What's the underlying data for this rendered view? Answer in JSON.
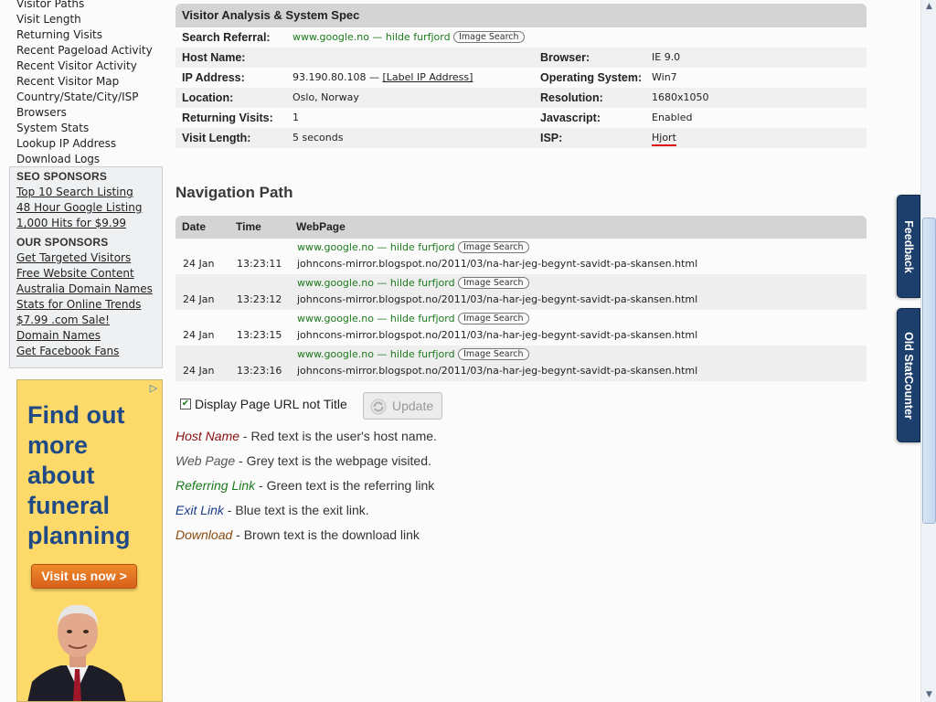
{
  "sidebar": {
    "links": [
      "Visitor Paths",
      "Visit Length",
      "Returning Visits",
      "Recent Pageload Activity",
      "Recent Visitor Activity",
      "Recent Visitor Map",
      "Country/State/City/ISP",
      "Browsers",
      "System Stats",
      "Lookup IP Address",
      "Download Logs"
    ],
    "seo_header": "SEO SPONSORS",
    "seo_links": [
      "Top 10 Search Listing",
      "48 Hour Google Listing",
      "1,000 Hits for $9.99"
    ],
    "our_header": "OUR SPONSORS",
    "our_links": [
      "Get Targeted Visitors",
      "Free Website Content",
      "Australia Domain Names",
      "Stats for Online Trends",
      "$7.99 .com Sale!",
      "Domain Names",
      "Get Facebook Fans"
    ]
  },
  "ad": {
    "headline_lines": [
      "Find out",
      "more",
      "about",
      "funeral",
      "planning"
    ],
    "cta": "Visit us now  >",
    "adchoices_icon": "adchoices-icon"
  },
  "spec": {
    "title": "Visitor Analysis & System Spec",
    "search_referral_label": "Search Referral:",
    "search_referral_value": "www.google.no — hilde furfjord",
    "image_search": "Image Search",
    "host_name_label": "Host Name:",
    "host_name_value": "",
    "ip_label": "IP Address:",
    "ip_value": "93.190.80.108 —",
    "label_ip": "[Label IP Address]",
    "location_label": "Location:",
    "location_value": "Oslo, Norway",
    "returning_label": "Returning Visits:",
    "returning_value": "1",
    "visit_length_label": "Visit Length:",
    "visit_length_value": "5 seconds",
    "browser_label": "Browser:",
    "browser_value": "IE 9.0",
    "os_label": "Operating System:",
    "os_value": "Win7",
    "resolution_label": "Resolution:",
    "resolution_value": "1680x1050",
    "javascript_label": "Javascript:",
    "javascript_value": "Enabled",
    "isp_label": "ISP:",
    "isp_value": "Hjort"
  },
  "nav": {
    "title": "Navigation Path",
    "col_date": "Date",
    "col_time": "Time",
    "col_webpage": "WebPage",
    "rows": [
      {
        "referrer": "www.google.no — hilde furfjord",
        "chip": "Image Search",
        "date": "24 Jan",
        "time": "13:23:11",
        "page": "johncons-mirror.blogspot.no/2011/03/na-har-jeg-begynt-savidt-pa-skansen.html"
      },
      {
        "referrer": "www.google.no — hilde furfjord",
        "chip": "Image Search",
        "date": "24 Jan",
        "time": "13:23:12",
        "page": "johncons-mirror.blogspot.no/2011/03/na-har-jeg-begynt-savidt-pa-skansen.html"
      },
      {
        "referrer": "www.google.no — hilde furfjord",
        "chip": "Image Search",
        "date": "24 Jan",
        "time": "13:23:15",
        "page": "johncons-mirror.blogspot.no/2011/03/na-har-jeg-begynt-savidt-pa-skansen.html"
      },
      {
        "referrer": "www.google.no — hilde furfjord",
        "chip": "Image Search",
        "date": "24 Jan",
        "time": "13:23:16",
        "page": "johncons-mirror.blogspot.no/2011/03/na-har-jeg-begynt-savidt-pa-skansen.html"
      }
    ]
  },
  "controls": {
    "checkbox_label": "Display Page URL not Title",
    "checkbox_checked": true,
    "update_label": "Update"
  },
  "legend": [
    {
      "term": "Host Name",
      "desc": " - Red text is the user's host name."
    },
    {
      "term": "Web Page",
      "desc": " - Grey text is the webpage visited."
    },
    {
      "term": "Referring Link",
      "desc": " - Green text is the referring link"
    },
    {
      "term": "Exit Link",
      "desc": " - Blue text is the exit link."
    },
    {
      "term": "Download",
      "desc": " - Brown text is the download link"
    }
  ],
  "tabs": {
    "feedback": "Feedback",
    "old_statcounter": "Old StatCounter"
  },
  "colors": {
    "host": "#8b1010",
    "web": "#555555",
    "referring": "#1c7a1c",
    "exit": "#1a3a8a",
    "download": "#8a4a10",
    "tab_bg": "#1d3f6b",
    "ad_bg": "#fdd96a",
    "cta": "#e2701f"
  }
}
